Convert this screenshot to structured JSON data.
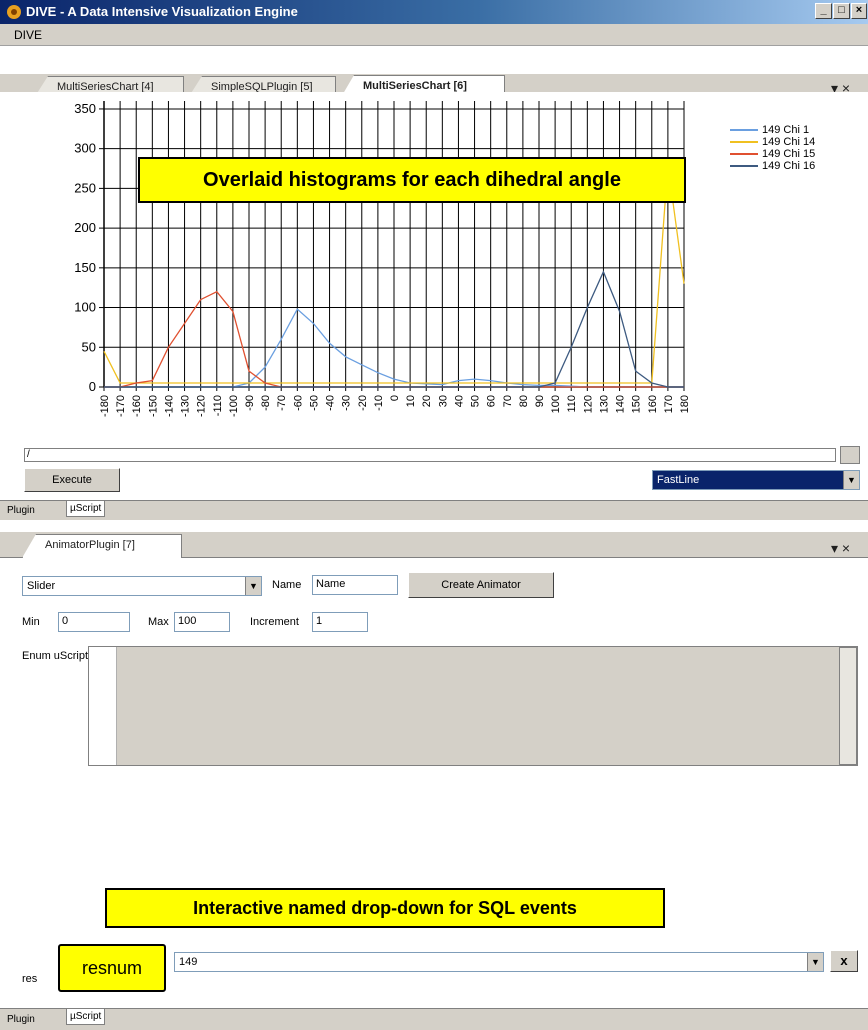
{
  "window": {
    "title": "DIVE - A Data Intensive Visualization Engine",
    "min_glyph": "_",
    "max_glyph": "□",
    "close_glyph": "×"
  },
  "menu": {
    "items": [
      "DIVE"
    ]
  },
  "top_tabs": {
    "tabs": [
      {
        "label": "MultiSeriesChart [4]"
      },
      {
        "label": "SimpleSQLPlugin [5]"
      },
      {
        "label": "MultiSeriesChart [6]",
        "active": true
      }
    ],
    "controls": "▾ ×"
  },
  "chart_data": {
    "type": "line",
    "x": [
      -180,
      -170,
      -160,
      -150,
      -140,
      -130,
      -120,
      -110,
      -100,
      -90,
      -80,
      -70,
      -60,
      -50,
      -40,
      -30,
      -20,
      -10,
      0,
      10,
      20,
      30,
      40,
      50,
      60,
      70,
      80,
      90,
      100,
      110,
      120,
      130,
      140,
      150,
      160,
      170,
      180
    ],
    "x_tick_labels": [
      "-180",
      "-170",
      "-160",
      "-150",
      "-140",
      "-130",
      "-120",
      "-110",
      "-100",
      "-90",
      "-80",
      "-70",
      "-60",
      "-50",
      "-40",
      "-30",
      "-20",
      "-10",
      "0",
      "10",
      "20",
      "30",
      "40",
      "50",
      "60",
      "70",
      "80",
      "90",
      "100",
      "110",
      "120",
      "130",
      "140",
      "150",
      "160",
      "170",
      "180"
    ],
    "y_ticks": [
      0,
      50,
      100,
      150,
      200,
      250,
      300,
      350
    ],
    "ylim": [
      0,
      360
    ],
    "xlim": [
      -180,
      180
    ],
    "grid": true,
    "legend_position": "top-right",
    "series": [
      {
        "name": "149 Chi 1",
        "color": "#6a9fe0",
        "values": [
          0,
          0,
          0,
          0,
          0,
          0,
          0,
          0,
          0,
          5,
          25,
          60,
          98,
          80,
          55,
          38,
          28,
          18,
          10,
          5,
          4,
          3,
          8,
          10,
          8,
          5,
          3,
          2,
          2,
          1,
          0,
          0,
          0,
          0,
          0,
          0,
          0
        ]
      },
      {
        "name": "149 Chi 14",
        "color": "#f0c020",
        "values": [
          45,
          5,
          5,
          5,
          5,
          5,
          5,
          5,
          5,
          5,
          5,
          5,
          5,
          5,
          5,
          5,
          5,
          5,
          5,
          5,
          5,
          5,
          5,
          5,
          5,
          5,
          5,
          5,
          5,
          5,
          5,
          5,
          5,
          5,
          5,
          280,
          130
        ]
      },
      {
        "name": "149 Chi 15",
        "color": "#e05030",
        "values": [
          0,
          0,
          5,
          8,
          50,
          80,
          110,
          120,
          95,
          20,
          5,
          0,
          0,
          0,
          0,
          0,
          0,
          0,
          0,
          0,
          0,
          0,
          0,
          0,
          0,
          0,
          0,
          0,
          0,
          0,
          0,
          0,
          0,
          0,
          0,
          0,
          0
        ]
      },
      {
        "name": "149 Chi 16",
        "color": "#3d5a80",
        "values": [
          0,
          0,
          0,
          0,
          0,
          0,
          0,
          0,
          0,
          0,
          0,
          0,
          0,
          0,
          0,
          0,
          0,
          0,
          0,
          0,
          0,
          0,
          0,
          0,
          0,
          0,
          0,
          0,
          5,
          50,
          100,
          145,
          95,
          20,
          5,
          0,
          0
        ]
      }
    ]
  },
  "callouts": {
    "chart": "Overlaid histograms for each dihedral angle",
    "dropdown": "Interactive named drop-down for SQL events",
    "resnum": "resnum"
  },
  "chart_panel": {
    "script_value": "/",
    "execute_label": "Execute",
    "chart_type_value": "FastLine",
    "bottom_tabs": [
      "Plugin",
      "µScript"
    ]
  },
  "lower_tabs": {
    "tabs": [
      {
        "label": "AnimatorPlugin [7]",
        "active": true
      }
    ],
    "controls": "▾ ×"
  },
  "animator": {
    "type_value": "Slider",
    "name_label": "Name",
    "name_value": "Name",
    "create_label": "Create Animator",
    "min_label": "Min",
    "min_value": "0",
    "max_label": "Max",
    "max_value": "100",
    "increment_label": "Increment",
    "increment_value": "1",
    "enum_label": "Enum uScript",
    "res_label": "res",
    "res_value": "149",
    "clear_label": "x",
    "bottom_tabs": [
      "Plugin",
      "µScript"
    ]
  }
}
